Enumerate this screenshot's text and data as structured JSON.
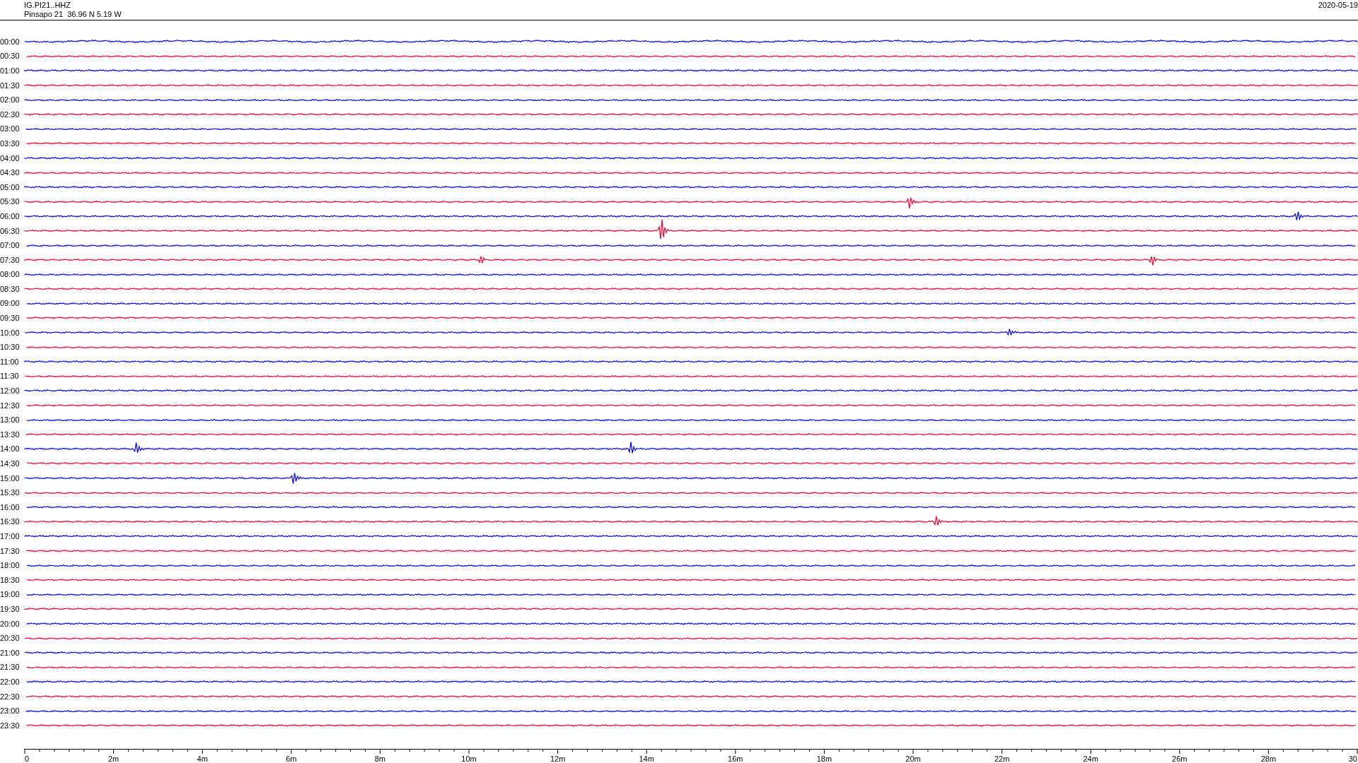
{
  "header": {
    "station": "IG.PI21..HHZ",
    "location": "Pinsapo 21  36.96 N 5.19 W",
    "date": "2020-05-19"
  },
  "rows": [
    {
      "label": "00:00",
      "color": "#0000ff"
    },
    {
      "label": "00:30",
      "color": "#ff0033"
    },
    {
      "label": "01:00",
      "color": "#0000ff"
    },
    {
      "label": "01:30",
      "color": "#ff0033"
    },
    {
      "label": "02:00",
      "color": "#0000ff"
    },
    {
      "label": "02:30",
      "color": "#ff0033"
    },
    {
      "label": "03:00",
      "color": "#0000ff"
    },
    {
      "label": "03:30",
      "color": "#ff0033"
    },
    {
      "label": "04:00",
      "color": "#0000ff"
    },
    {
      "label": "04:30",
      "color": "#ff0033"
    },
    {
      "label": "05:00",
      "color": "#0000ff"
    },
    {
      "label": "05:30",
      "color": "#ff0033"
    },
    {
      "label": "06:00",
      "color": "#0000ff"
    },
    {
      "label": "06:30",
      "color": "#ff0033"
    },
    {
      "label": "07:00",
      "color": "#0000ff"
    },
    {
      "label": "07:30",
      "color": "#ff0033"
    },
    {
      "label": "08:00",
      "color": "#0000ff"
    },
    {
      "label": "08:30",
      "color": "#ff0033"
    },
    {
      "label": "09:00",
      "color": "#0000ff"
    },
    {
      "label": "09:30",
      "color": "#ff0033"
    },
    {
      "label": "10:00",
      "color": "#0000ff"
    },
    {
      "label": "10:30",
      "color": "#ff0033"
    },
    {
      "label": "11:00",
      "color": "#0000ff"
    },
    {
      "label": "11:30",
      "color": "#ff0033"
    },
    {
      "label": "12:00",
      "color": "#0000ff"
    },
    {
      "label": "12:30",
      "color": "#ff0033"
    },
    {
      "label": "13:00",
      "color": "#0000ff"
    },
    {
      "label": "13:30",
      "color": "#ff0033"
    },
    {
      "label": "14:00",
      "color": "#0000ff"
    },
    {
      "label": "14:30",
      "color": "#ff0033"
    },
    {
      "label": "15:00",
      "color": "#0000ff"
    },
    {
      "label": "15:30",
      "color": "#ff0033"
    },
    {
      "label": "16:00",
      "color": "#0000ff"
    },
    {
      "label": "16:30",
      "color": "#ff0033"
    },
    {
      "label": "17:00",
      "color": "#0000ff"
    },
    {
      "label": "17:30",
      "color": "#ff0033"
    },
    {
      "label": "18:00",
      "color": "#0000ff"
    },
    {
      "label": "18:30",
      "color": "#ff0033"
    },
    {
      "label": "19:00",
      "color": "#0000ff"
    },
    {
      "label": "19:30",
      "color": "#ff0033"
    },
    {
      "label": "20:00",
      "color": "#0000ff"
    },
    {
      "label": "20:30",
      "color": "#ff0033"
    },
    {
      "label": "21:00",
      "color": "#0000ff"
    },
    {
      "label": "21:30",
      "color": "#ff0033"
    },
    {
      "label": "22:00",
      "color": "#0000ff"
    },
    {
      "label": "22:30",
      "color": "#ff0033"
    },
    {
      "label": "23:00",
      "color": "#0000ff"
    },
    {
      "label": "23:30",
      "color": "#ff0033"
    }
  ],
  "x_axis": {
    "labels": [
      "0",
      "2m",
      "4m",
      "6m",
      "8m",
      "10m",
      "12m",
      "14m",
      "16m",
      "18m",
      "20m",
      "22m",
      "24m",
      "26m",
      "28m",
      "30"
    ]
  }
}
